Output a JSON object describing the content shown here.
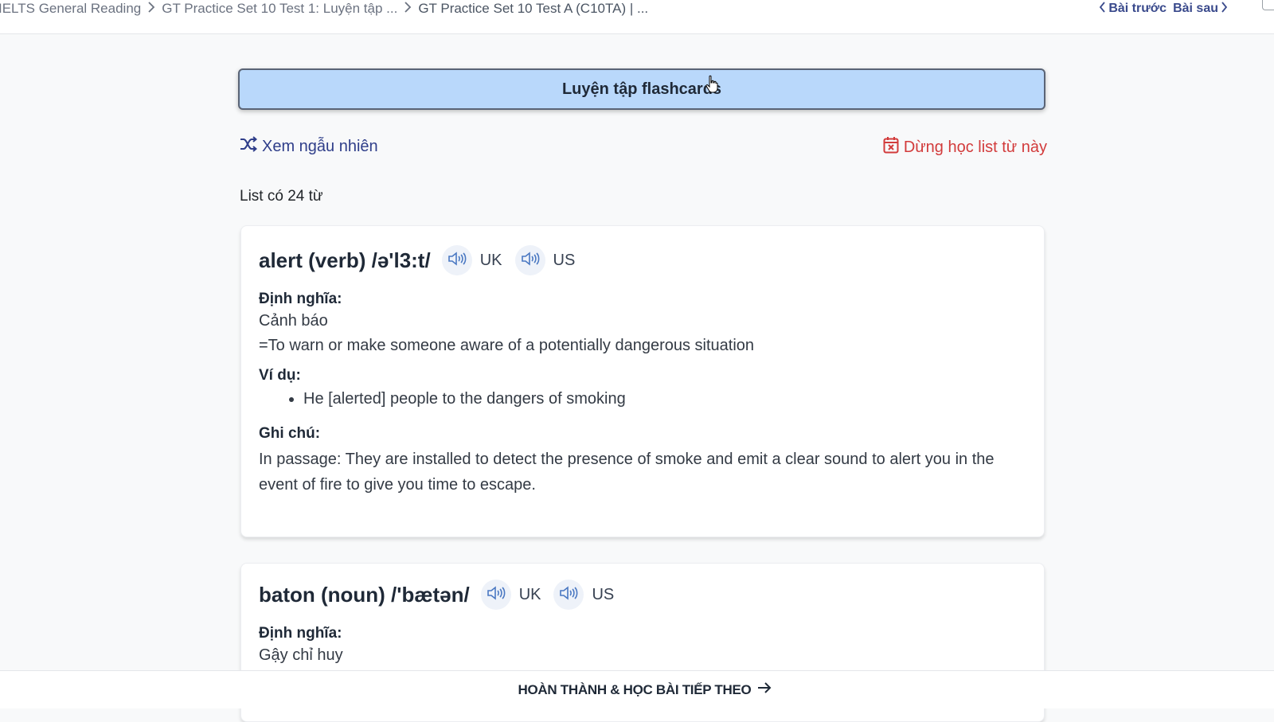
{
  "breadcrumb": [
    "IELTS General Reading",
    "GT Practice Set 10 Test 1: Luyện tập ...",
    "GT Practice Set 10 Test A (C10TA) | ..."
  ],
  "nav": {
    "prev": "Bài trước",
    "next": "Bài sau"
  },
  "flashcard_button": "Luyện tập flashcards",
  "actions": {
    "shuffle": "Xem ngẫu nhiên",
    "stop": "Dừng học list từ này"
  },
  "list_count": "List có 24 từ",
  "words": [
    {
      "title": "alert (verb) /ə'l3:t/",
      "uk": "UK",
      "us": "US",
      "definition_label": "Định nghĩa:",
      "definition_vi": "Cảnh báo",
      "definition_en": "=To warn or make someone aware of a potentially dangerous situation",
      "example_label": "Ví dụ:",
      "examples": [
        "He [alerted] people to the dangers of smoking"
      ],
      "note_label": "Ghi chú:",
      "note": "In passage: They are installed to detect the presence of smoke and emit a clear sound to alert you in the event of fire to give you time to escape."
    },
    {
      "title": "baton (noun) /'bætən/",
      "uk": "UK",
      "us": "US",
      "definition_label": "Định nghĩa:",
      "definition_vi": "Gậy chỉ huy"
    }
  ],
  "bottom": {
    "complete": "HOÀN THÀNH & HỌC BÀI TIẾP THEO"
  },
  "colors": {
    "button_bg": "#b9d8fb",
    "link_blue": "#2f3e8a",
    "stop_red": "#d23b3b",
    "audio_blue": "#4a78c2"
  },
  "icons": [
    "chevron-right-icon",
    "chevron-left-icon",
    "shuffle-icon",
    "calendar-x-icon",
    "speaker-icon",
    "arrow-right-icon",
    "cursor-icon"
  ]
}
